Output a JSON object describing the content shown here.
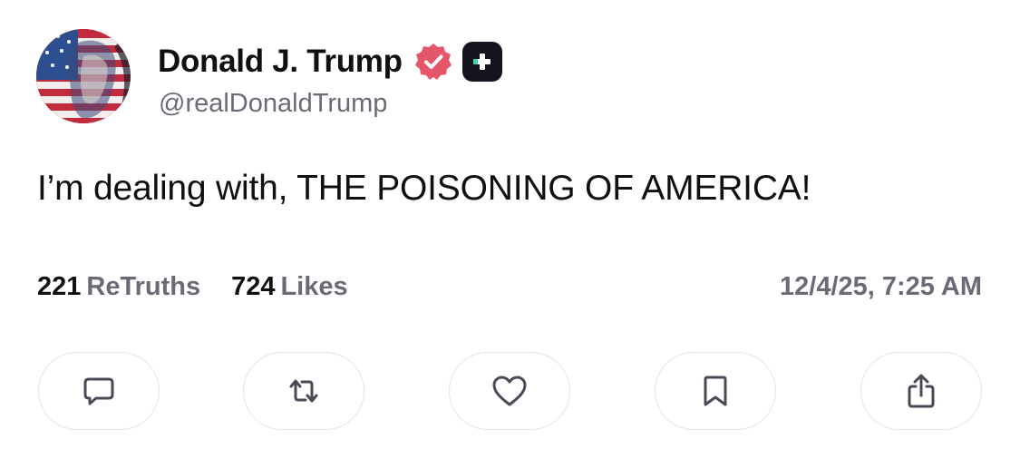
{
  "profile": {
    "display_name": "Donald J. Trump",
    "handle": "@realDonaldTrump",
    "verified_icon": "verified-badge-icon",
    "badge_icon": "truth-plus-icon",
    "verified_color": "#e5566a"
  },
  "post": {
    "text": "I’m dealing with, THE POISONING OF AMERICA!",
    "retruths_count": "221",
    "retruths_label": "ReTruths",
    "likes_count": "724",
    "likes_label": "Likes",
    "timestamp": "12/4/25, 7:25 AM"
  },
  "actions": [
    {
      "name": "reply",
      "icon": "reply-icon"
    },
    {
      "name": "retruth",
      "icon": "retruth-icon"
    },
    {
      "name": "like",
      "icon": "heart-icon"
    },
    {
      "name": "bookmark",
      "icon": "bookmark-icon"
    },
    {
      "name": "share",
      "icon": "share-icon"
    }
  ],
  "colors": {
    "text_primary": "#0f0f14",
    "text_secondary": "#6b6b78",
    "button_border": "#e4e4ea",
    "icon_color": "#4a4a57"
  }
}
